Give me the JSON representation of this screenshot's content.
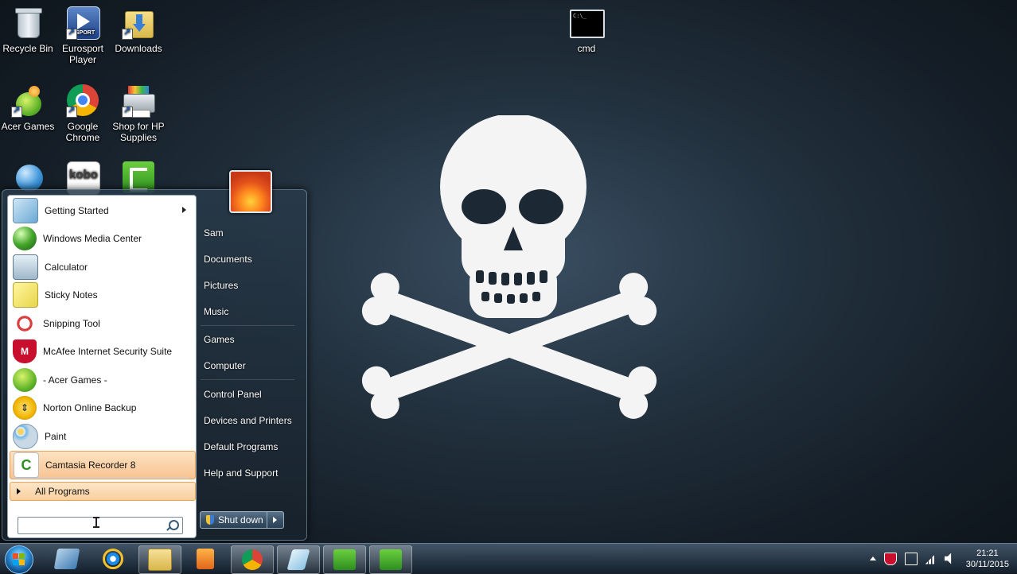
{
  "desktop": {
    "icons": [
      {
        "label": "Recycle Bin",
        "icon": "recycle-bin-icon"
      },
      {
        "label": "Eurosport Player",
        "icon": "eurosport-player-icon",
        "badge": "SPORT"
      },
      {
        "label": "Downloads",
        "icon": "folder-download-icon"
      },
      {
        "label": "Acer Games",
        "icon": "acer-games-icon"
      },
      {
        "label": "Google Chrome",
        "icon": "chrome-icon"
      },
      {
        "label": "Shop for HP Supplies",
        "icon": "hp-printer-icon"
      },
      {
        "label": "",
        "icon": "internet-globe-icon"
      },
      {
        "label": "",
        "icon": "kobo-icon",
        "badge": "kobo"
      },
      {
        "label": "",
        "icon": "camtasia-icon"
      },
      {
        "label": "cmd",
        "icon": "cmd-icon",
        "badge": "C:\\_"
      }
    ]
  },
  "start_menu": {
    "programs": [
      {
        "label": "Getting Started",
        "icon": "getting-started-icon",
        "has_submenu": true
      },
      {
        "label": "Windows Media Center",
        "icon": "media-center-icon"
      },
      {
        "label": "Calculator",
        "icon": "calculator-icon"
      },
      {
        "label": "Sticky Notes",
        "icon": "sticky-notes-icon"
      },
      {
        "label": "Snipping Tool",
        "icon": "snipping-tool-icon"
      },
      {
        "label": "McAfee Internet Security Suite",
        "icon": "mcafee-icon"
      },
      {
        "label": "-  Acer Games  -",
        "icon": "acer-games-icon"
      },
      {
        "label": "Norton Online Backup",
        "icon": "norton-icon"
      },
      {
        "label": "Paint",
        "icon": "paint-icon"
      },
      {
        "label": "Camtasia Recorder 8",
        "icon": "camtasia-icon",
        "highlighted": true
      }
    ],
    "all_programs": "All Programs",
    "search_placeholder": "",
    "right_items": [
      "Sam",
      "Documents",
      "Pictures",
      "Music",
      "Games",
      "Computer",
      "Control Panel",
      "Devices and Printers",
      "Default Programs",
      "Help and Support"
    ],
    "shutdown_label": "Shut down"
  },
  "taskbar": {
    "apps": [
      "media-center-taskbar-icon",
      "internet-explorer-icon",
      "file-explorer-icon",
      "media-player-icon",
      "chrome-icon",
      "calculator-taskbar-icon",
      "camtasia-taskbar-icon",
      "camtasia-recorder-taskbar-icon"
    ],
    "clock_time": "21:21",
    "clock_date": "30/11/2015"
  }
}
